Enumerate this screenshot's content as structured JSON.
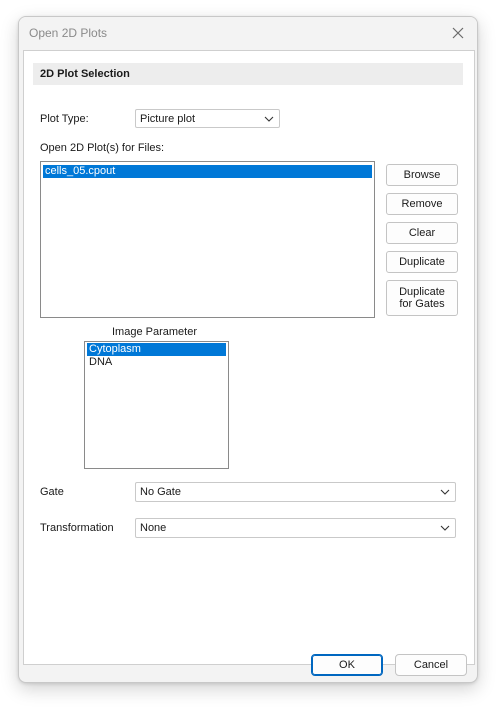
{
  "window": {
    "title": "Open 2D Plots",
    "close_icon": "close-icon"
  },
  "section": {
    "title": "2D Plot Selection"
  },
  "plot_type": {
    "label": "Plot Type:",
    "value": "Picture plot"
  },
  "files": {
    "label": "Open 2D Plot(s) for Files:",
    "items": [
      "cells_05.cpout"
    ],
    "selected_index": 0
  },
  "file_buttons": {
    "browse": "Browse",
    "remove": "Remove",
    "clear": "Clear",
    "duplicate": "Duplicate",
    "duplicate_gates_line1": "Duplicate",
    "duplicate_gates_line2": "for Gates"
  },
  "image_parameter": {
    "label": "Image Parameter",
    "items": [
      "Cytoplasm",
      "DNA"
    ],
    "selected_index": 0
  },
  "gate": {
    "label": "Gate",
    "value": "No Gate"
  },
  "transformation": {
    "label": "Transformation",
    "value": "None"
  },
  "footer": {
    "ok": "OK",
    "cancel": "Cancel"
  },
  "colors": {
    "selection": "#0078d7",
    "primary_border": "#0067c0"
  }
}
